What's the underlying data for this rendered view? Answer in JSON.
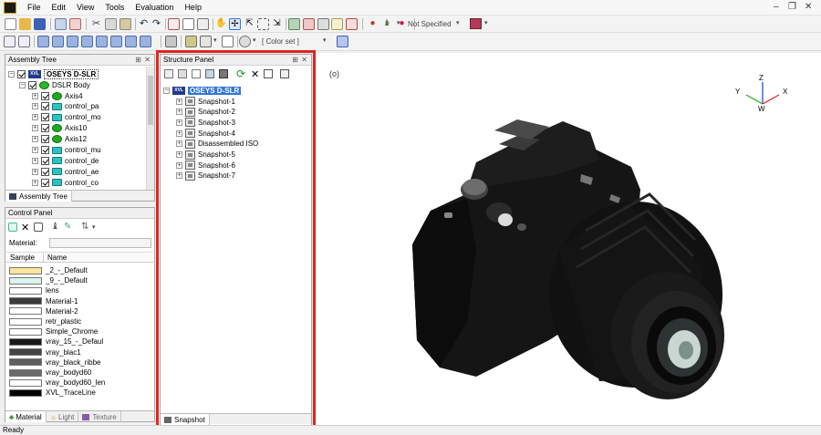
{
  "menu": [
    "File",
    "Edit",
    "View",
    "Tools",
    "Evaluation",
    "Help"
  ],
  "toolbar": {
    "not_specified": "Not Specified",
    "color_set": "[ Color set ]"
  },
  "assembly_tree": {
    "title": "Assembly Tree",
    "root": "OSEYS D-SLR",
    "body": "DSLR Body",
    "items": [
      {
        "label": "Axis4",
        "icon": "axis"
      },
      {
        "label": "control_pa",
        "icon": "control"
      },
      {
        "label": "control_mo",
        "icon": "control"
      },
      {
        "label": "Axis10",
        "icon": "axis"
      },
      {
        "label": "Axis12",
        "icon": "axis"
      },
      {
        "label": "control_mu",
        "icon": "control"
      },
      {
        "label": "control_de",
        "icon": "control"
      },
      {
        "label": "control_ae",
        "icon": "control"
      },
      {
        "label": "control_co",
        "icon": "control"
      }
    ],
    "tab": "Assembly Tree"
  },
  "control_panel": {
    "title": "Control Panel",
    "material_label": "Material:",
    "col_sample": "Sample",
    "col_name": "Name",
    "materials": [
      {
        "name": "_2_-_Default",
        "color": "#fde6a0"
      },
      {
        "name": "_9_-_Default",
        "color": "#d9f3ee"
      },
      {
        "name": "lens",
        "color": "#ffffff"
      },
      {
        "name": "Material-1",
        "color": "#3a3a3a"
      },
      {
        "name": "Material-2",
        "color": "#ffffff"
      },
      {
        "name": "retr_plastic",
        "color": "#ffffff"
      },
      {
        "name": "Simple_Chrome",
        "color": "#ffffff"
      },
      {
        "name": "vray_15_-_Defaul",
        "color": "#1a1a1a"
      },
      {
        "name": "vray_blac1",
        "color": "#444444"
      },
      {
        "name": "vray_black_ribbe",
        "color": "#5e5e5e"
      },
      {
        "name": "vray_bodyd60",
        "color": "#6a6a6a"
      },
      {
        "name": "vray_bodyd60_len",
        "color": "#ffffff"
      },
      {
        "name": "XVL_TraceLine",
        "color": "#000000"
      }
    ],
    "tabs": [
      "Material",
      "Light",
      "Texture"
    ]
  },
  "structure_panel": {
    "title": "Structure Panel",
    "root": "OSEYS D-SLR",
    "items": [
      "Snapshot-1",
      "Snapshot-2",
      "Snapshot-3",
      "Snapshot-4",
      "Disassembled ISO",
      "Snapshot-5",
      "Snapshot-6",
      "Snapshot-7"
    ],
    "tab": "Snapshot"
  },
  "viewport": {
    "axis_z": "Z",
    "axis_y": "Y",
    "axis_x": "X",
    "axis_w": "W",
    "view_icon": "(o)"
  },
  "status": "Ready",
  "colors": {
    "highlight_box": "#e0261f",
    "selection": "#3375d6"
  }
}
